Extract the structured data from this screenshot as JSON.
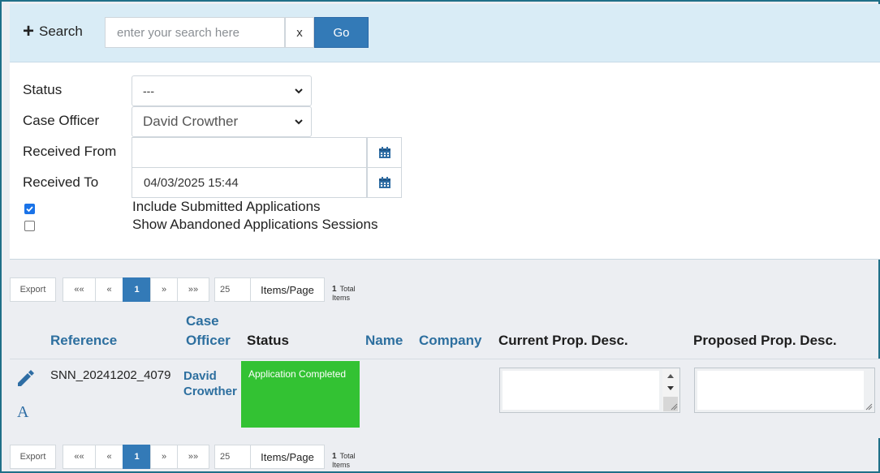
{
  "search": {
    "toggle_label": "Search",
    "placeholder": "enter your search here",
    "clear_label": "x",
    "go_label": "Go"
  },
  "filters": {
    "status_label": "Status",
    "status_value": "---",
    "officer_label": "Case Officer",
    "officer_value": "David Crowther",
    "received_from_label": "Received From",
    "received_from_value": "",
    "received_to_label": "Received To",
    "received_to_value": "04/03/2025 15:44",
    "include_submitted_label": "Include Submitted Applications",
    "include_submitted_checked": true,
    "show_abandoned_label": "Show Abandoned Applications Sessions",
    "show_abandoned_checked": false
  },
  "pager": {
    "export_label": "Export",
    "first": "««",
    "prev": "«",
    "page": "1",
    "next": "»",
    "last": "»»",
    "page_size": "25",
    "items_per_page_label": "Items/Page",
    "total_count": "1",
    "total_label": "Total Items"
  },
  "table": {
    "headers": {
      "reference": "Reference",
      "case_officer_1": "Case",
      "case_officer_2": "Officer",
      "status": "Status",
      "name": "Name",
      "company": "Company",
      "current_desc": "Current Prop. Desc.",
      "proposed_desc": "Proposed Prop. Desc."
    },
    "rows": [
      {
        "reference": "SNN_20241202_4079",
        "officer_1": "David",
        "officer_2": "Crowther",
        "status": "Application Completed",
        "name": "",
        "company": ""
      }
    ]
  },
  "colors": {
    "accent": "#337ab7",
    "link": "#2d6f9f",
    "status_completed": "#33c233",
    "search_bar_bg": "#d9ecf6",
    "frame_border": "#1f6f88"
  },
  "icons": {
    "edit": "pencil-icon",
    "font": "font-icon",
    "calendar": "calendar-icon"
  }
}
